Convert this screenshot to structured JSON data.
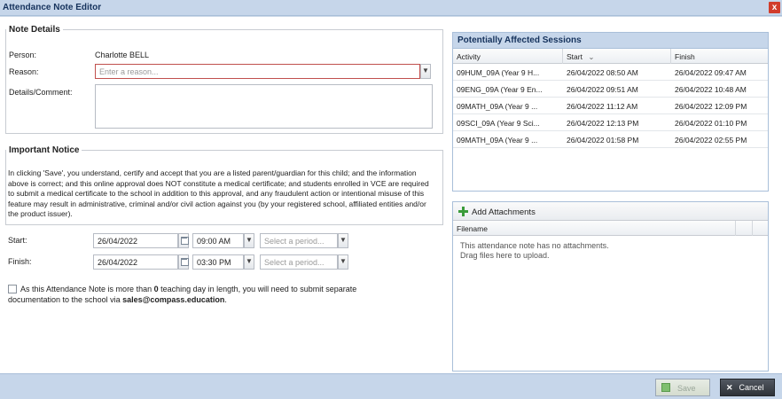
{
  "window": {
    "title": "Attendance Note Editor",
    "close_glyph": "x"
  },
  "note_details": {
    "legend": "Note Details",
    "person_label": "Person:",
    "person_value": "Charlotte BELL",
    "reason_label": "Reason:",
    "reason_placeholder": "Enter a reason...",
    "details_label": "Details/Comment:",
    "details_value": ""
  },
  "important_notice": {
    "legend": "Important Notice",
    "text": "In clicking 'Save', you understand, certify and accept that you are a listed parent/guardian for this child; and the information above is correct; and this online approval does NOT constitute a medical certificate; and students enrolled in VCE are required to submit a medical certificate to the school in addition to this approval, and any fraudulent action or intentional misuse of this feature may result in administrative, criminal and/or civil action against you (by your registered school, affiliated entities and/or the product issuer)."
  },
  "times": {
    "start_label": "Start:",
    "start_date": "26/04/2022",
    "start_time": "09:00 AM",
    "start_period_placeholder": "Select a period...",
    "finish_label": "Finish:",
    "finish_date": "26/04/2022",
    "finish_time": "03:30 PM",
    "finish_period_placeholder": "Select a period..."
  },
  "teaching_day": {
    "text_1": "As this Attendance Note is more than ",
    "count": "0",
    "text_2": " teaching day in length, you will need to submit separate",
    "text_3": "documentation to the school via ",
    "email": "sales@compass.education",
    "text_4": "."
  },
  "sessions": {
    "title": "Potentially Affected Sessions",
    "columns": {
      "activity": "Activity",
      "start": "Start",
      "finish": "Finish",
      "sort_glyph": "⌄"
    },
    "rows": [
      {
        "activity": "09HUM_09A (Year 9 H...",
        "start": "26/04/2022 08:50 AM",
        "finish": "26/04/2022 09:47 AM"
      },
      {
        "activity": "09ENG_09A (Year 9 En...",
        "start": "26/04/2022 09:51 AM",
        "finish": "26/04/2022 10:48 AM"
      },
      {
        "activity": "09MATH_09A (Year 9 ...",
        "start": "26/04/2022 11:12 AM",
        "finish": "26/04/2022 12:09 PM"
      },
      {
        "activity": "09SCI_09A (Year 9 Sci...",
        "start": "26/04/2022 12:13 PM",
        "finish": "26/04/2022 01:10 PM"
      },
      {
        "activity": "09MATH_09A (Year 9 ...",
        "start": "26/04/2022 01:58 PM",
        "finish": "26/04/2022 02:55 PM"
      }
    ]
  },
  "attachments": {
    "add_label": "Add Attachments",
    "filename_header": "Filename",
    "empty_line_1": "This attendance note has no attachments.",
    "empty_line_2": "Drag files here to upload."
  },
  "footer": {
    "save_label": "Save",
    "cancel_label": "Cancel"
  },
  "colors": {
    "accent": "#c6d6ea",
    "error_border": "#c0504d",
    "add_icon": "#3a9b3a",
    "close": "#d13c2b"
  },
  "icons": [
    "close-icon",
    "chevron-down-icon",
    "calendar-icon",
    "plus-icon",
    "save-icon",
    "cancel-icon"
  ]
}
